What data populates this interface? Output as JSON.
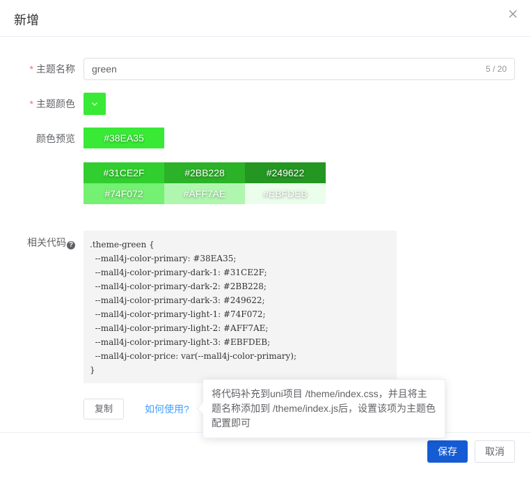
{
  "dialog": {
    "title": "新增"
  },
  "form": {
    "name": {
      "required_mark": "*",
      "label": "主题名称",
      "value": "green",
      "count": "5 / 20"
    },
    "color": {
      "required_mark": "*",
      "label": "主题颜色",
      "value": "#38EA35"
    },
    "preview": {
      "label": "颜色预览",
      "primary": {
        "label": "#38EA35",
        "color": "#38EA35"
      },
      "dark": [
        {
          "label": "#31CE2F",
          "color": "#31CE2F"
        },
        {
          "label": "#2BB228",
          "color": "#2BB228"
        },
        {
          "label": "#249622",
          "color": "#249622"
        }
      ],
      "light": [
        {
          "label": "#74F072",
          "color": "#74F072"
        },
        {
          "label": "#AFF7AE",
          "color": "#AFF7AE"
        },
        {
          "label": "#EBFDEB",
          "color": "#EBFDEB"
        }
      ]
    },
    "code": {
      "label": "相关代码",
      "help_glyph": "?",
      "text": ".theme-green {\n  --mall4j-color-primary: #38EA35;\n  --mall4j-color-primary-dark-1: #31CE2F;\n  --mall4j-color-primary-dark-2: #2BB228;\n  --mall4j-color-primary-dark-3: #249622;\n  --mall4j-color-primary-light-1: #74F072;\n  --mall4j-color-primary-light-2: #AFF7AE;\n  --mall4j-color-primary-light-3: #EBFDEB;\n  --mall4j-color-price: var(--mall4j-color-primary);\n}"
    },
    "copy_label": "复制",
    "howto_label": "如何使用?",
    "tooltip": "将代码补充到uni项目 /theme/index.css，并且将主题名称添加到 /theme/index.js后，设置该项为主题色配置即可"
  },
  "footer": {
    "save_label": "保存",
    "cancel_label": "取消"
  },
  "icons": {
    "close": "close-icon",
    "chevron": "chevron-down-icon",
    "help": "help-icon"
  },
  "colors": {
    "primary_button": "#155bd4",
    "link": "#409eff",
    "required": "#f56c6c"
  }
}
